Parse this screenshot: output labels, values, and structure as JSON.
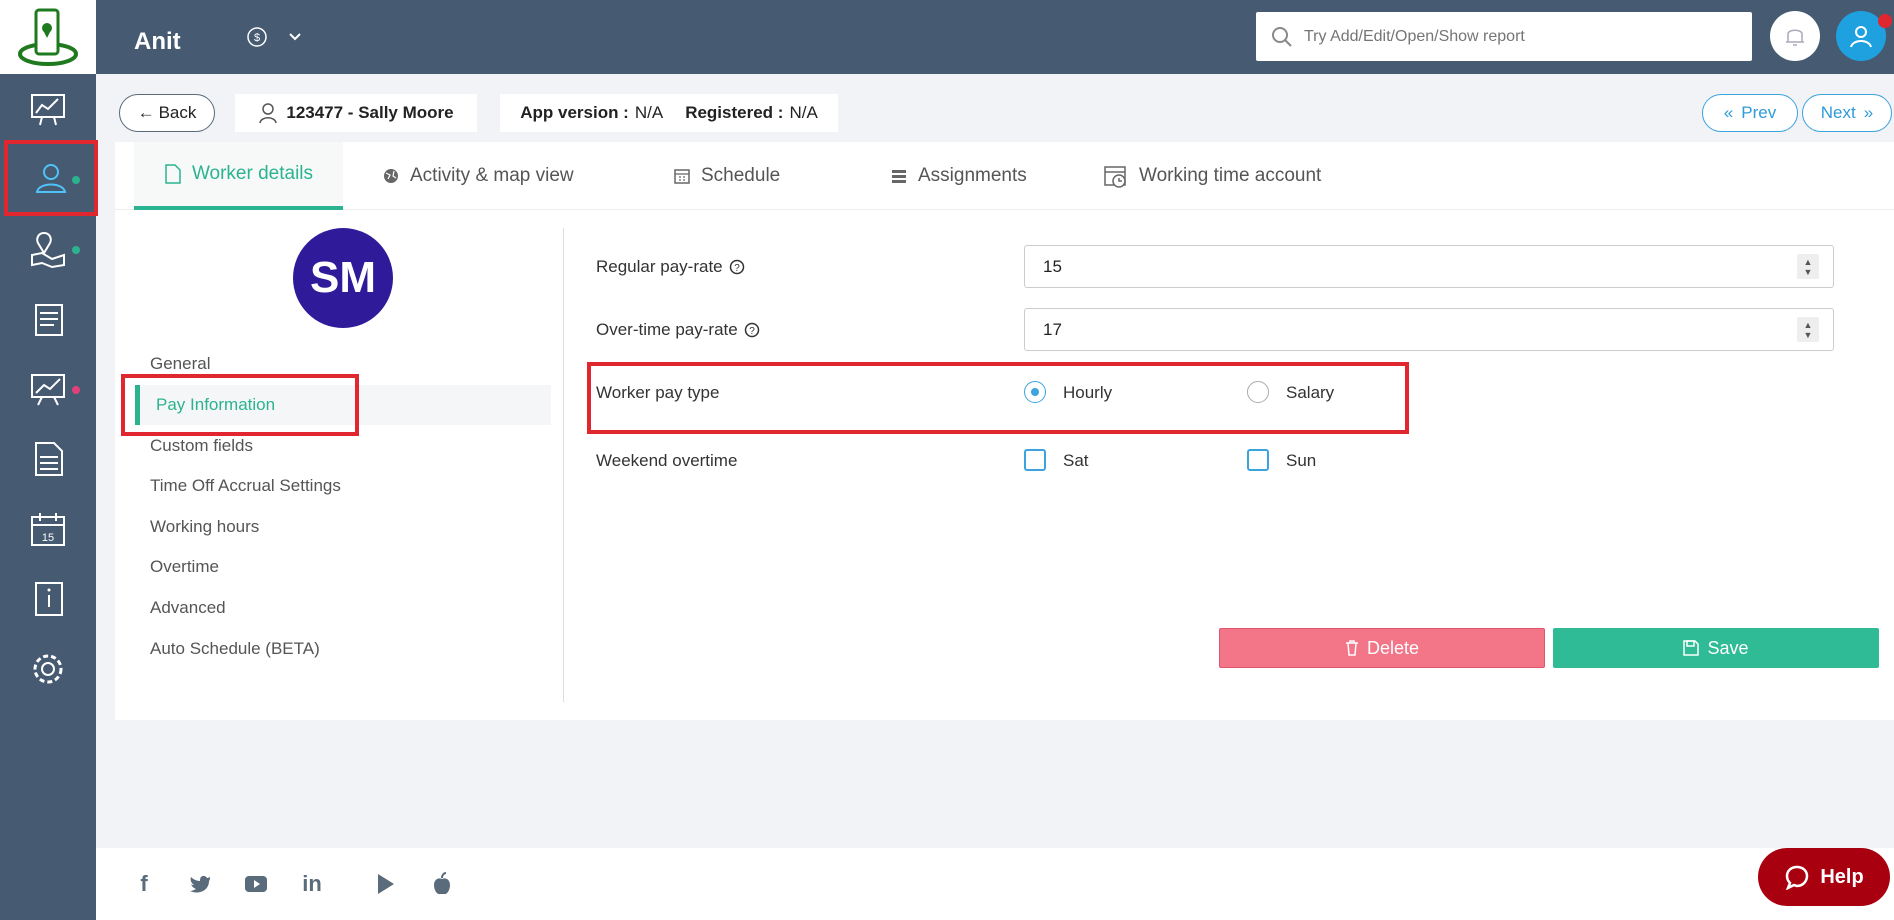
{
  "topbar": {
    "company": "Anit",
    "search_placeholder": "Try Add/Edit/Open/Show report"
  },
  "subheader": {
    "back_label": "Back",
    "worker": "123477 - Sally Moore",
    "app_version_label": "App version :",
    "app_version_value": "N/A",
    "registered_label": "Registered :",
    "registered_value": "N/A",
    "prev_label": "Prev",
    "next_label": "Next"
  },
  "tabs": [
    {
      "label": "Worker details",
      "icon": "document-icon"
    },
    {
      "label": "Activity & map view",
      "icon": "globe-icon"
    },
    {
      "label": "Schedule",
      "icon": "calendar-icon"
    },
    {
      "label": "Assignments",
      "icon": "list-icon"
    },
    {
      "label": "Working time account",
      "icon": "clock-calendar-icon"
    }
  ],
  "profile": {
    "initials": "SM"
  },
  "menu": [
    "General",
    "Pay Information",
    "Custom fields",
    "Time Off Accrual Settings",
    "Working hours",
    "Overtime",
    "Advanced",
    "Auto Schedule (BETA)"
  ],
  "form": {
    "regular_label": "Regular pay-rate",
    "regular_value": "15",
    "overtime_label": "Over-time pay-rate",
    "overtime_value": "17",
    "pay_type_label": "Worker pay type",
    "pay_type_options": [
      "Hourly",
      "Salary"
    ],
    "pay_type_selected": "Hourly",
    "weekend_label": "Weekend overtime",
    "weekend_options": [
      "Sat",
      "Sun"
    ]
  },
  "buttons": {
    "delete": "Delete",
    "save": "Save"
  },
  "help": "Help",
  "colors": {
    "sidebar": "#465a72",
    "accent": "#2bb38f",
    "highlight": "#e0262f",
    "delete": "#f27588",
    "save": "#2fbb95",
    "avatar": "#2f1a99"
  }
}
